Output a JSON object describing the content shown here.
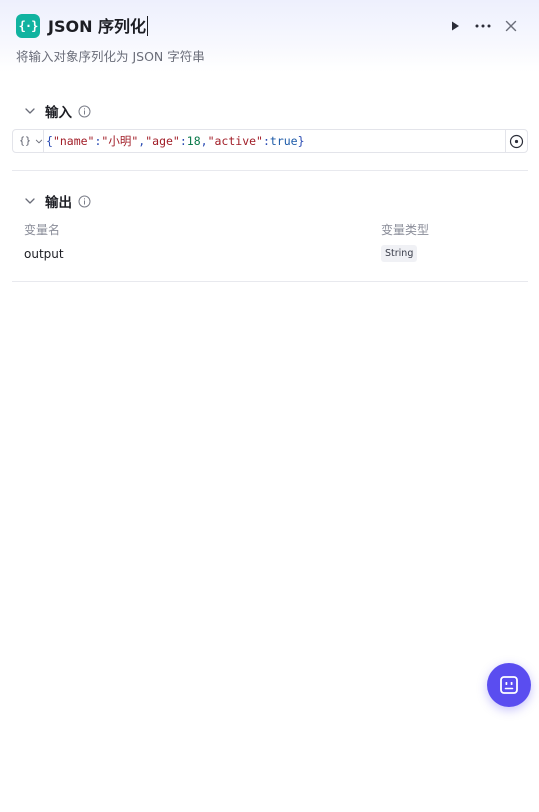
{
  "header": {
    "icon_glyph": "{·}",
    "title": "JSON 序列化",
    "subtitle": "将输入对象序列化为 JSON 字符串",
    "accent": "#11b3a0",
    "actions": [
      "run-icon",
      "more-icon",
      "close-icon"
    ]
  },
  "input_section": {
    "title": "输入",
    "type_glyph": "{}",
    "value_tokens": [
      {
        "t": "{",
        "k": "punc"
      },
      {
        "t": "\"name\"",
        "k": "key"
      },
      {
        "t": ":",
        "k": "punc"
      },
      {
        "t": "\"小明\"",
        "k": "str"
      },
      {
        "t": ",",
        "k": "punc"
      },
      {
        "t": "\"age\"",
        "k": "key"
      },
      {
        "t": ":",
        "k": "punc"
      },
      {
        "t": "18",
        "k": "num"
      },
      {
        "t": ",",
        "k": "punc"
      },
      {
        "t": "\"active\"",
        "k": "key"
      },
      {
        "t": ":",
        "k": "punc"
      },
      {
        "t": "true",
        "k": "bool"
      },
      {
        "t": "}",
        "k": "punc"
      }
    ]
  },
  "output_section": {
    "title": "输出",
    "columns": {
      "name": "变量名",
      "type": "变量类型"
    },
    "rows": [
      {
        "name": "output",
        "type": "String"
      }
    ]
  },
  "fab": {
    "icon": "robot-face-icon",
    "color": "#5a4df0"
  }
}
